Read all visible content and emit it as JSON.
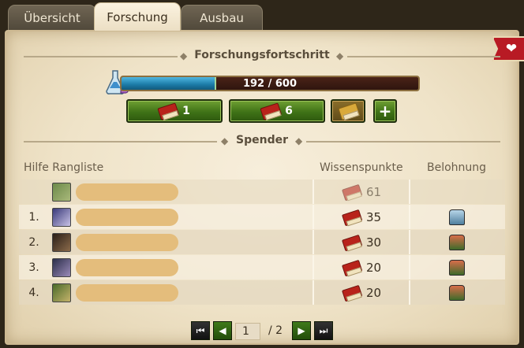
{
  "tabs": [
    {
      "label": "Übersicht",
      "active": false
    },
    {
      "label": "Forschung",
      "active": true
    },
    {
      "label": "Ausbau",
      "active": false
    }
  ],
  "research": {
    "section_title": "Forschungsfortschritt",
    "progress_text": "192 / 600",
    "progress_fraction": 0.32,
    "buttons": [
      {
        "label": "1",
        "icon": "red-book-icon"
      },
      {
        "label": "6",
        "icon": "red-book-icon"
      },
      {
        "label": "",
        "icon": "gold-book-icon"
      },
      {
        "label": "+",
        "icon": "plus-icon"
      }
    ]
  },
  "donors": {
    "section_title": "Spender",
    "columns": {
      "rank": "Hilfe Rangliste",
      "points": "Wissenspunkte",
      "reward": "Belohnung"
    },
    "rows": [
      {
        "rank": "",
        "points": "61",
        "reward": "",
        "faded": true
      },
      {
        "rank": "1.",
        "points": "35",
        "reward": "blue-chest-icon"
      },
      {
        "rank": "2.",
        "points": "30",
        "reward": "red-chest-icon"
      },
      {
        "rank": "3.",
        "points": "20",
        "reward": "red-chest-icon"
      },
      {
        "rank": "4.",
        "points": "20",
        "reward": "red-chest-icon"
      }
    ]
  },
  "pagination": {
    "current_page": "1",
    "total": "/ 2"
  },
  "colors": {
    "panel": "#efe3c8",
    "progress_fill": "#1b7aa6",
    "button_green": "#3f7217",
    "ribbon": "#b81a24"
  }
}
